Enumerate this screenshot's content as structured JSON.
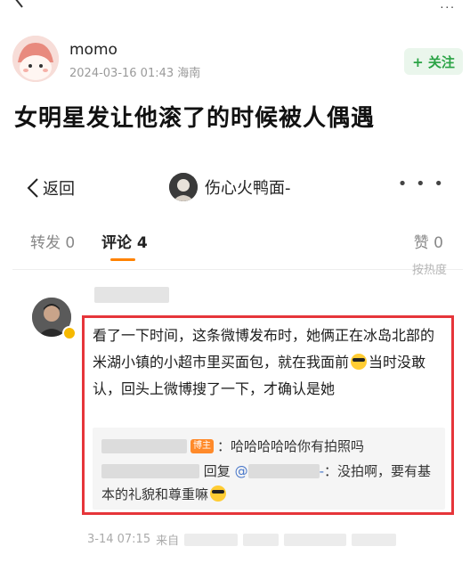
{
  "top": {
    "more": "..."
  },
  "author": {
    "name": "momo",
    "date": "2024-03-16 01:43",
    "location": "海南",
    "follow_label": "+ 关注"
  },
  "post": {
    "title": "女明星发让他滚了的时候被人偶遇"
  },
  "embed": {
    "back_label": "返回",
    "user_name": "伤心火鸭面-",
    "more": "• • •",
    "tabs": [
      {
        "label": "转发 0"
      },
      {
        "label": "评论 4"
      },
      {
        "label": "赞 0"
      }
    ],
    "sort_hint": "按热度",
    "comment": {
      "text_1": "看了一下时间，这条微博发布时，她俩正在冰岛北部的米湖小镇的小超市里买面包，就在我面前",
      "text_2": "当时没敢认，回头上微博搜了一下，才确认是她",
      "replies": [
        {
          "badge": "博主",
          "text": "：哈哈哈哈哈你有拍照吗"
        },
        {
          "reply_word": "回复",
          "mention_prefix": "@",
          "mention_suffix": "-",
          "text_1": "：没拍啊，要有基本的礼貌和尊重嘛"
        }
      ],
      "timestamp": "3-14 07:15",
      "source_prefix": "来自"
    }
  },
  "colors": {
    "accent_orange": "#ff8200",
    "highlight_red": "#e6353a",
    "follow_green": "#2aa345"
  }
}
